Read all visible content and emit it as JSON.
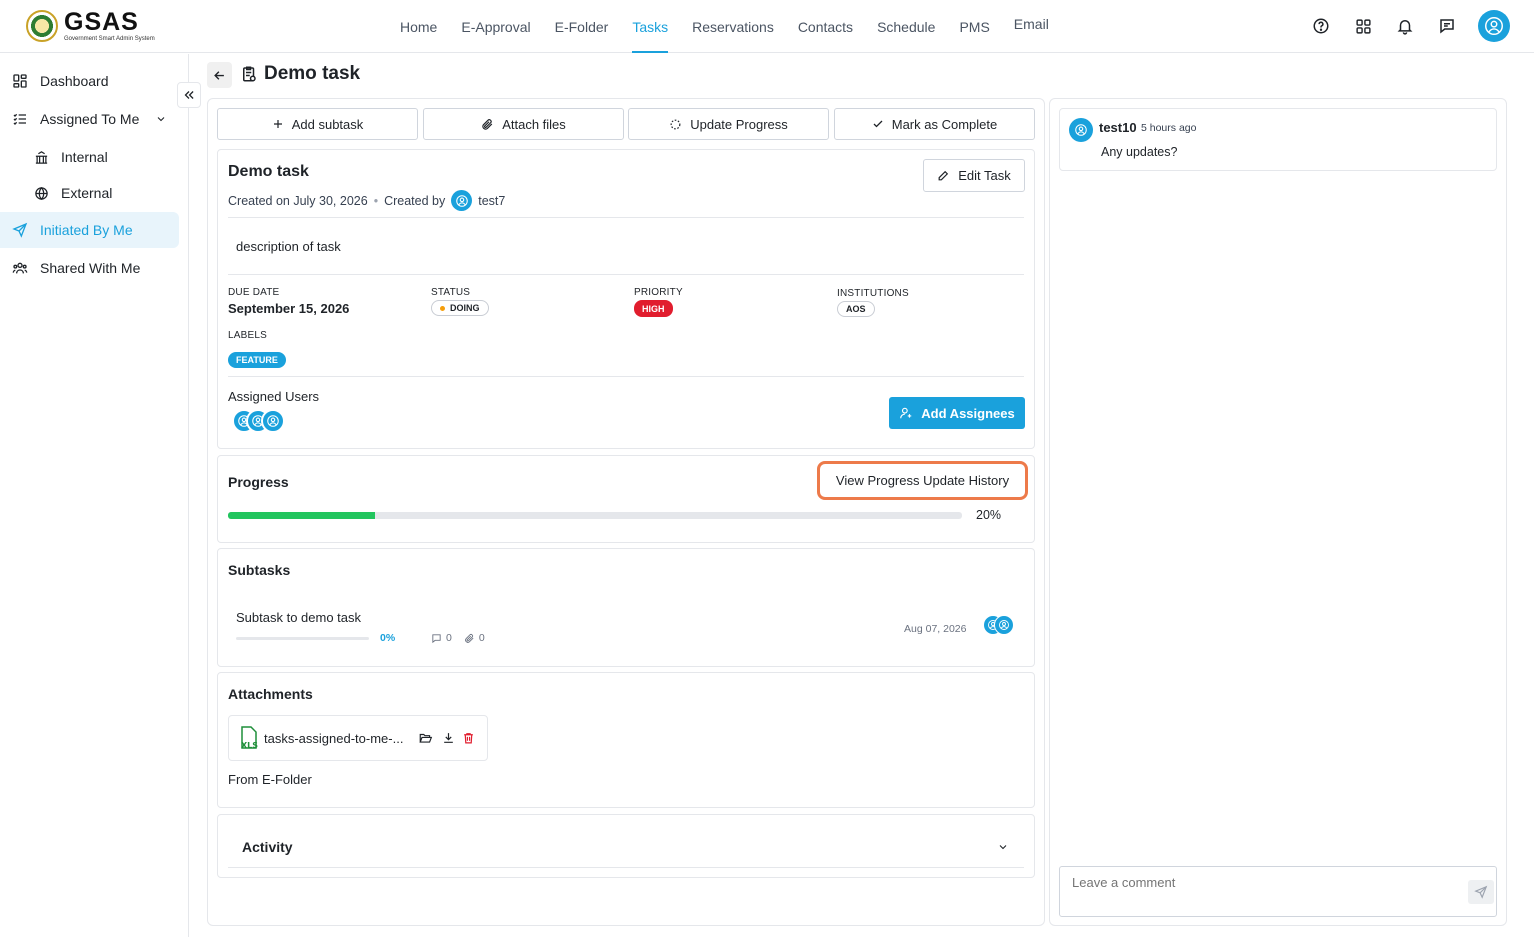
{
  "header": {
    "logo_text": "GSAS",
    "logo_subtitle": "Government Smart Admin System",
    "nav": [
      "Home",
      "E-Approval",
      "E-Folder",
      "Tasks",
      "Reservations",
      "Contacts",
      "Schedule",
      "PMS",
      "Email"
    ],
    "active_nav": "Tasks",
    "icons": [
      "help-icon",
      "apps-grid-icon",
      "bell-icon",
      "messages-icon",
      "user-avatar-icon"
    ]
  },
  "sidebar": {
    "items": [
      {
        "label": "Dashboard",
        "icon": "dashboard-icon"
      },
      {
        "label": "Assigned To Me",
        "icon": "checklist-icon"
      },
      {
        "label": "Internal",
        "icon": "institution-icon"
      },
      {
        "label": "External",
        "icon": "globe-icon"
      },
      {
        "label": "Initiated By Me",
        "icon": "send-icon"
      },
      {
        "label": "Shared With Me",
        "icon": "users-icon"
      }
    ],
    "active": "Initiated By Me"
  },
  "page": {
    "title": "Demo task"
  },
  "actions": {
    "add_subtask": "Add subtask",
    "attach_files": "Attach files",
    "update_progress": "Update Progress",
    "mark_complete": "Mark as Complete"
  },
  "task": {
    "title": "Demo task",
    "created_on": "Created on July 30, 2026",
    "created_by_label": "Created by",
    "created_by": "test7",
    "edit_label": "Edit Task",
    "description": "description of task",
    "due_date_label": "DUE DATE",
    "due_date": "September 15, 2026",
    "status_label": "STATUS",
    "status": "DOING",
    "priority_label": "PRIORITY",
    "priority": "HIGH",
    "institutions_label": "INSTITUTIONS",
    "institution": "AOS",
    "labels_label": "LABELS",
    "label": "FEATURE",
    "assigned_label": "Assigned Users",
    "add_assignees": "Add Assignees"
  },
  "progress": {
    "title": "Progress",
    "history_button": "View Progress Update History",
    "value": 0.2,
    "value_text": "20%"
  },
  "subtasks": {
    "title": "Subtasks",
    "items": [
      {
        "name": "Subtask to demo task",
        "progress": "0%",
        "comments": "0",
        "attachments": "0",
        "date": "Aug 07, 2026"
      }
    ]
  },
  "attachments": {
    "title": "Attachments",
    "file_name": "tasks-assigned-to-me-...",
    "source": "From E-Folder"
  },
  "activity": {
    "title": "Activity"
  },
  "comments": {
    "items": [
      {
        "user": "test10",
        "time": "5 hours ago",
        "text": "Any updates?"
      }
    ],
    "placeholder": "Leave a comment"
  }
}
